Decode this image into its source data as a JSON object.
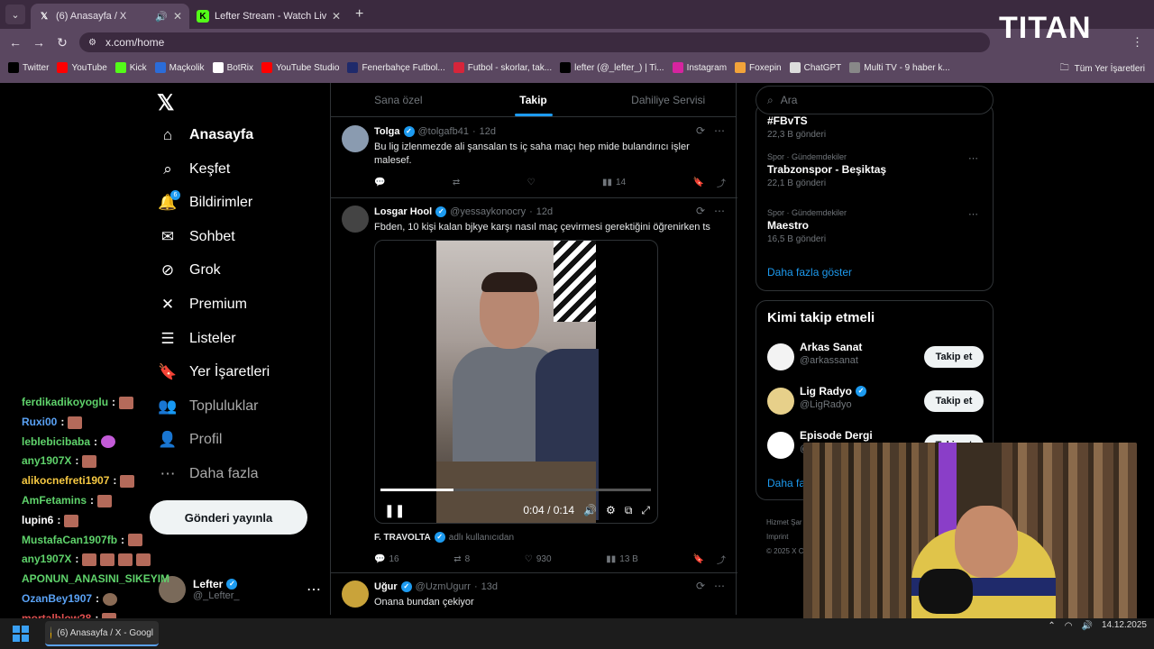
{
  "browser": {
    "tabs": [
      {
        "title": "(6) Anasayfa / X",
        "icon": "x-logo-icon",
        "audio": true,
        "active": true
      },
      {
        "title": "Lefter Stream - Watch Live on K",
        "icon": "kick-icon",
        "active": false
      }
    ],
    "url": "x.com/home",
    "bookmarks": [
      {
        "label": "Twitter",
        "icon": "x-logo-icon",
        "color": "#000000"
      },
      {
        "label": "YouTube",
        "icon": "youtube-icon",
        "color": "#ff0000"
      },
      {
        "label": "Kick",
        "icon": "kick-icon",
        "color": "#53fc18"
      },
      {
        "label": "Maçkolik",
        "icon": "mackolik-icon",
        "color": "#2b6cd8"
      },
      {
        "label": "BotRix",
        "icon": "botrix-icon",
        "color": "#ffffff"
      },
      {
        "label": "YouTube Studio",
        "icon": "youtube-studio-icon",
        "color": "#ff0000"
      },
      {
        "label": "Fenerbahçe Futbol...",
        "icon": "fenerbahce-icon",
        "color": "#1f2a6b"
      },
      {
        "label": "Futbol - skorlar, tak...",
        "icon": "flashscore-icon",
        "color": "#d6253a"
      },
      {
        "label": "lefter (@_lefter_) | Ti...",
        "icon": "tiktok-icon",
        "color": "#000000"
      },
      {
        "label": "Instagram",
        "icon": "instagram-icon",
        "color": "#d6249f"
      },
      {
        "label": "Foxepin",
        "icon": "foxepin-icon",
        "color": "#f2a33a"
      },
      {
        "label": "ChatGPT",
        "icon": "chatgpt-icon",
        "color": "#dddddd"
      },
      {
        "label": "Multi TV - 9 haber k...",
        "icon": "multitv-icon",
        "color": "#888888"
      }
    ],
    "all_bookmarks": "Tüm Yer İşaretleri"
  },
  "overlay": {
    "brand": "TITAN"
  },
  "sidebar": {
    "items": [
      {
        "label": "Anasayfa",
        "icon": "home-icon",
        "glyph": "⌂"
      },
      {
        "label": "Keşfet",
        "icon": "search-icon",
        "glyph": "⌕"
      },
      {
        "label": "Bildirimler",
        "icon": "bell-icon",
        "glyph": "🔔",
        "badge": "6"
      },
      {
        "label": "Sohbet",
        "icon": "mail-icon",
        "glyph": "✉"
      },
      {
        "label": "Grok",
        "icon": "grok-icon",
        "glyph": "⊘"
      },
      {
        "label": "Premium",
        "icon": "x-premium-icon",
        "glyph": "✕"
      },
      {
        "label": "Listeler",
        "icon": "list-icon",
        "glyph": "☰"
      },
      {
        "label": "Yer İşaretleri",
        "icon": "bookmark-icon",
        "glyph": "🔖"
      },
      {
        "label": "Topluluklar",
        "icon": "communities-icon",
        "glyph": "👥"
      },
      {
        "label": "Profil",
        "icon": "profile-icon",
        "glyph": "👤"
      },
      {
        "label": "Daha fazla",
        "icon": "more-icon",
        "glyph": "⋯"
      }
    ],
    "post_button": "Gönderi yayınla",
    "account": {
      "name": "Lefter",
      "handle": "@_Lefter_"
    }
  },
  "feed": {
    "tabs": [
      "Sana özel",
      "Takip",
      "Dahiliye Servisi"
    ],
    "active_tab": 1,
    "tweets": [
      {
        "name": "Tolga",
        "handle": "@tolgafb41",
        "time": "12d",
        "text": "Bu lig izlenmezde ali şansalan ts iç saha maçı hep mide bulandırıcı işler malesef.",
        "views": "14",
        "avatar_color": "#8a9bb0"
      },
      {
        "name": "Losgar Hool",
        "handle": "@yessaykonocry",
        "time": "12d",
        "text": "Fbden, 10 kişi kalan bjkye karşı nasıl maç çevirmesi gerektiğini öğrenirken ts",
        "video": {
          "time": "0:04 / 0:14",
          "progress": 0.27
        },
        "credit_name": "F. TRAVOLTA",
        "credit_suffix": "adlı kullanıcıdan",
        "replies": "16",
        "reposts": "8",
        "likes": "930",
        "views": "13 B",
        "avatar_color": "#444444"
      },
      {
        "name": "Uğur",
        "handle": "@UzmUgurr",
        "time": "13d",
        "text": "Onana bundan çekiyor",
        "avatar_color": "#c9a33a"
      }
    ]
  },
  "right": {
    "search_placeholder": "Ara",
    "trends": [
      {
        "category": "",
        "name": "#FBvTS",
        "count": "22,3 B gönderi"
      },
      {
        "category": "Spor · Gündemdekiler",
        "name": "Trabzonspor - Beşiktaş",
        "count": "22,1 B gönderi"
      },
      {
        "category": "Spor · Gündemdekiler",
        "name": "Maestro",
        "count": "16,5 B gönderi"
      }
    ],
    "show_more": "Daha fazla göster",
    "who_title": "Kimi takip etmeli",
    "who": [
      {
        "name": "Arkas Sanat",
        "handle": "@arkassanat",
        "verified": false,
        "button": "Takip et"
      },
      {
        "name": "Lig Radyo",
        "handle": "@LigRadyo",
        "verified": true,
        "button": "Takip et"
      },
      {
        "name": "Episode Dergi",
        "handle": "@",
        "verified": false,
        "button": "Takip et"
      }
    ],
    "who_more": "Daha fa",
    "footer": [
      "Hizmet Şar",
      "Imprint",
      "© 2025 X C"
    ]
  },
  "chat": [
    {
      "user": "ferdikadikoyoglu",
      "color": "#5fd36b",
      "emotes": 1
    },
    {
      "user": "Ruxi00",
      "color": "#5aa2f5",
      "emotes": 1
    },
    {
      "user": "leblebicibaba",
      "color": "#5fd36b",
      "emotes": 1,
      "emote_style": "p"
    },
    {
      "user": "any1907X",
      "color": "#5fd36b",
      "emotes": 1
    },
    {
      "user": "alikocnefreti1907",
      "color": "#f5c842",
      "emotes": 1
    },
    {
      "user": "AmFetamins",
      "color": "#5fd36b",
      "emotes": 1
    },
    {
      "user": "lupin6",
      "color": "#ffffff",
      "emotes": 1
    },
    {
      "user": "MustafaCan1907fb",
      "color": "#5fd36b",
      "emotes": 1
    },
    {
      "user": "any1907X",
      "color": "#5fd36b",
      "emotes": 4
    },
    {
      "user": "APONUN_ANASINI_SIKEYIM",
      "color": "#5fd36b",
      "emotes": 0,
      "nocolon": true
    },
    {
      "user": "OzanBey1907",
      "color": "#5aa2f5",
      "emotes": 1,
      "emote_style": "g"
    },
    {
      "user": "mortalblow28",
      "color": "#e05050",
      "emotes": 1
    }
  ],
  "taskbar": {
    "app": "(6) Anasayfa / X - Googl",
    "date": "14.12.2025"
  }
}
